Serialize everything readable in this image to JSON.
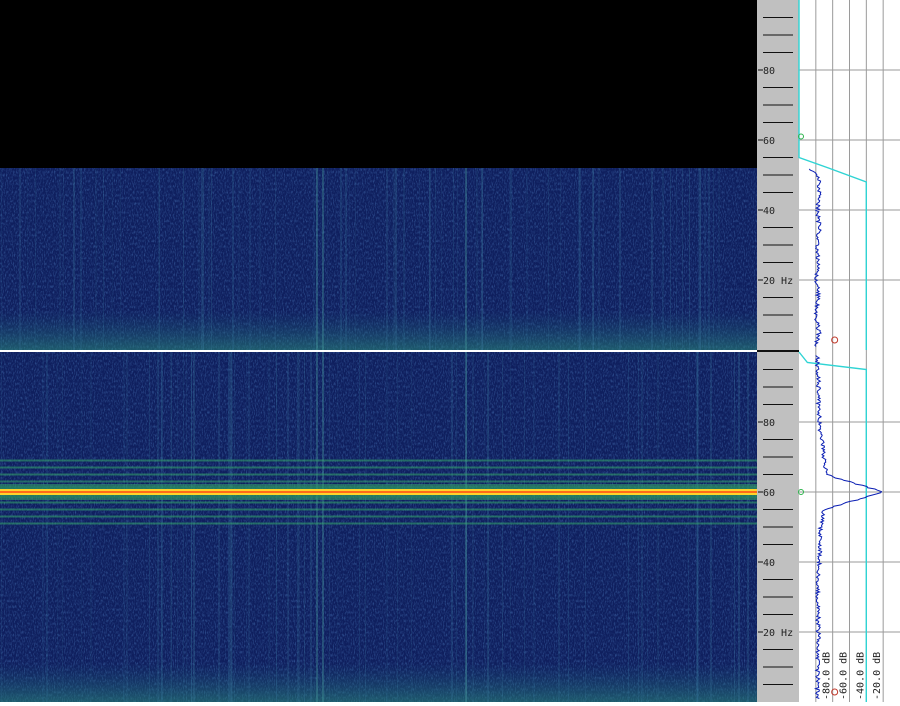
{
  "chart_data": [
    {
      "type": "heatmap",
      "channel": 1,
      "y_unit_label": "Hz",
      "y_ticks": [
        20,
        40,
        60,
        80
      ],
      "y_tick_labels": [
        "20 Hz",
        "40",
        "60",
        "80"
      ],
      "ylim": [
        0,
        100
      ],
      "frequency_cutoff_hz": 52,
      "spectrum_profile": [
        {
          "hz": 1,
          "db": -100
        },
        {
          "hz": 5,
          "db": -96
        },
        {
          "hz": 10,
          "db": -100
        },
        {
          "hz": 15,
          "db": -97
        },
        {
          "hz": 20,
          "db": -99
        },
        {
          "hz": 25,
          "db": -97
        },
        {
          "hz": 30,
          "db": -98
        },
        {
          "hz": 35,
          "db": -96
        },
        {
          "hz": 40,
          "db": -98
        },
        {
          "hz": 45,
          "db": -96
        },
        {
          "hz": 50,
          "db": -97
        },
        {
          "hz": 52,
          "db": -110
        }
      ],
      "cumulative_curve": [
        {
          "hz": 0,
          "db": -40
        },
        {
          "hz": 48,
          "db": -40
        },
        {
          "hz": 52,
          "db": -85
        },
        {
          "hz": 55,
          "db": -120
        },
        {
          "hz": 100,
          "db": -120
        }
      ]
    },
    {
      "type": "heatmap",
      "channel": 2,
      "y_unit_label": "Hz",
      "y_ticks": [
        20,
        40,
        60,
        80
      ],
      "y_tick_labels": [
        "20 Hz",
        "40",
        "60",
        "80"
      ],
      "ylim": [
        0,
        100
      ],
      "dominant_tone_hz": 60,
      "harmonic_lines_hz": [
        51,
        53,
        55,
        57,
        58,
        62,
        63,
        65,
        67,
        69
      ],
      "spectrum_profile": [
        {
          "hz": 1,
          "db": -98
        },
        {
          "hz": 10,
          "db": -98
        },
        {
          "hz": 20,
          "db": -97
        },
        {
          "hz": 30,
          "db": -98
        },
        {
          "hz": 40,
          "db": -96
        },
        {
          "hz": 50,
          "db": -94
        },
        {
          "hz": 55,
          "db": -90
        },
        {
          "hz": 60,
          "db": -20
        },
        {
          "hz": 65,
          "db": -88
        },
        {
          "hz": 70,
          "db": -90
        },
        {
          "hz": 80,
          "db": -96
        },
        {
          "hz": 90,
          "db": -97
        },
        {
          "hz": 99,
          "db": -98
        }
      ],
      "cumulative_curve": [
        {
          "hz": 0,
          "db": -40
        },
        {
          "hz": 95,
          "db": -40
        },
        {
          "hz": 97,
          "db": -110
        },
        {
          "hz": 100,
          "db": -120
        }
      ]
    }
  ],
  "db_axis": {
    "labels": [
      "-80.0 dB",
      "-60.0 dB",
      "-40.0 dB",
      "-20.0 dB"
    ],
    "values": [
      -80,
      -60,
      -40,
      -20
    ],
    "range": [
      -120,
      0
    ]
  },
  "colors": {
    "spectrogram_bg": "#0f1f5e",
    "tone": "#ffd42a",
    "tone_core": "#ff6a1a",
    "harmonic": "#34a86b",
    "scale_bg": "#c0c0c0",
    "spectrum_line": "#0a1eb4",
    "cumulative_line": "#2fd4d4",
    "divider": "#ffffff"
  }
}
